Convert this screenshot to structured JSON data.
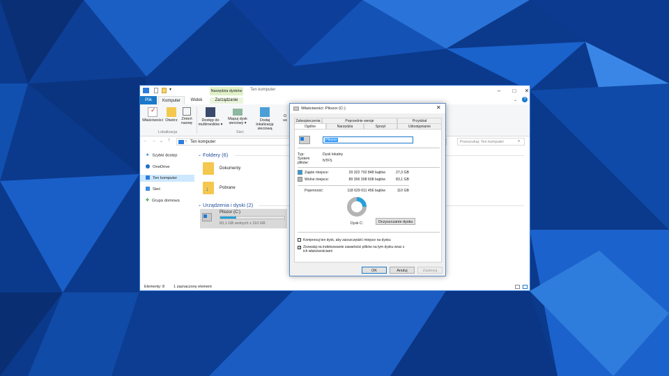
{
  "explorer": {
    "title": "Ten komputer",
    "context_tab_header": "Narzędzia dysków",
    "tabs": [
      "Plik",
      "Komputer",
      "Widok",
      "Zarządzanie"
    ],
    "ribbon": {
      "buttons": [
        {
          "label": "Właściwości"
        },
        {
          "label": "Otwórz"
        },
        {
          "label": "Zmień nazwę"
        },
        {
          "label": "Dostęp do multimediów ▾"
        },
        {
          "label": "Mapuj dysk sieciowy ▾"
        },
        {
          "label": "Dodaj lokalizację sieciową"
        },
        {
          "label": "O us"
        }
      ],
      "groups": [
        "Lokalizacja",
        "Sieć"
      ]
    },
    "address": "Ten komputer",
    "search_placeholder": "Przeszukaj: Ten komputer",
    "nav": [
      "Szybki dostęp",
      "OneDrive",
      "Ten komputer",
      "Sieć",
      "Grupa domowa"
    ],
    "sections": {
      "folders": "Foldery (6)",
      "devices": "Urządzenia i dyski (2)"
    },
    "folders": [
      {
        "name": "Dokumenty"
      },
      {
        "name": "Pobrane"
      }
    ],
    "drive": {
      "name": "Pliozor (C:)",
      "free_text": "83,1 GB wolnych z 110 GB",
      "used_fraction": 0.245
    },
    "status": {
      "count": "Elementy: 8",
      "selected": "1 zaznaczony element"
    }
  },
  "props": {
    "title": "Właściwości: Pliozor (C:)",
    "tabs_row1": [
      "Zabezpieczenia",
      "Poprzednie wersje",
      "Przydział"
    ],
    "tabs_row2": [
      "Ogólne",
      "Narzędzia",
      "Sprzęt",
      "Udostępnianie"
    ],
    "name_value": "Pliozor",
    "type_label": "Typ:",
    "type_value": "Dysk lokalny",
    "fs_label": "System plików:",
    "fs_value": "NTFS",
    "used_label": "Zajęte miejsce:",
    "used_bytes": "29 322 702 848 bajtów",
    "used_gb": "27,3 GB",
    "free_label": "Wolne miejsce:",
    "free_bytes": "89 306 308 608 bajtów",
    "free_gb": "83,1 GB",
    "cap_label": "Pojemność:",
    "cap_bytes": "118 629 011 456 bajtów",
    "cap_gb": "110 GB",
    "drive_label": "Dysk C:",
    "cleanup_button": "Oczyszczanie dysku",
    "compress_label": "Kompresuj ten dysk, aby zaoszczędzić miejsce na dysku",
    "index_label": "Zezwalaj na indeksowanie zawartości plików na tym dysku wraz z ich właściwościami",
    "ok": "OK",
    "cancel": "Anuluj",
    "apply": "Zastosuj",
    "used_fraction": 0.247,
    "colors": {
      "used": "#26a0da",
      "free": "#b4b4b4"
    }
  }
}
